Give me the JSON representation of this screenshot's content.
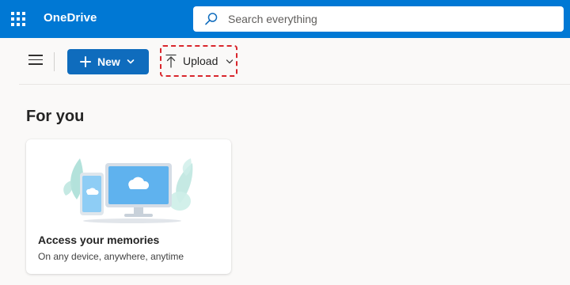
{
  "app": {
    "name": "OneDrive"
  },
  "icons": {
    "apps": "waffle-icon",
    "search": "search-icon",
    "menu": "hamburger-icon",
    "new": "plus-icon",
    "upload": "upload-arrow-icon",
    "dropdown": "chevron-down-icon"
  },
  "search": {
    "placeholder": "Search everything"
  },
  "toolbar": {
    "new_label": "New",
    "upload_label": "Upload"
  },
  "main": {
    "section_title": "For you",
    "cards": [
      {
        "title": "Access your memories",
        "subtitle": "On any device, anywhere, anytime"
      }
    ]
  },
  "colors": {
    "header": "#0078d4",
    "primary_button": "#0f6cbd",
    "highlight": "#d9262c",
    "background": "#faf9f8"
  }
}
